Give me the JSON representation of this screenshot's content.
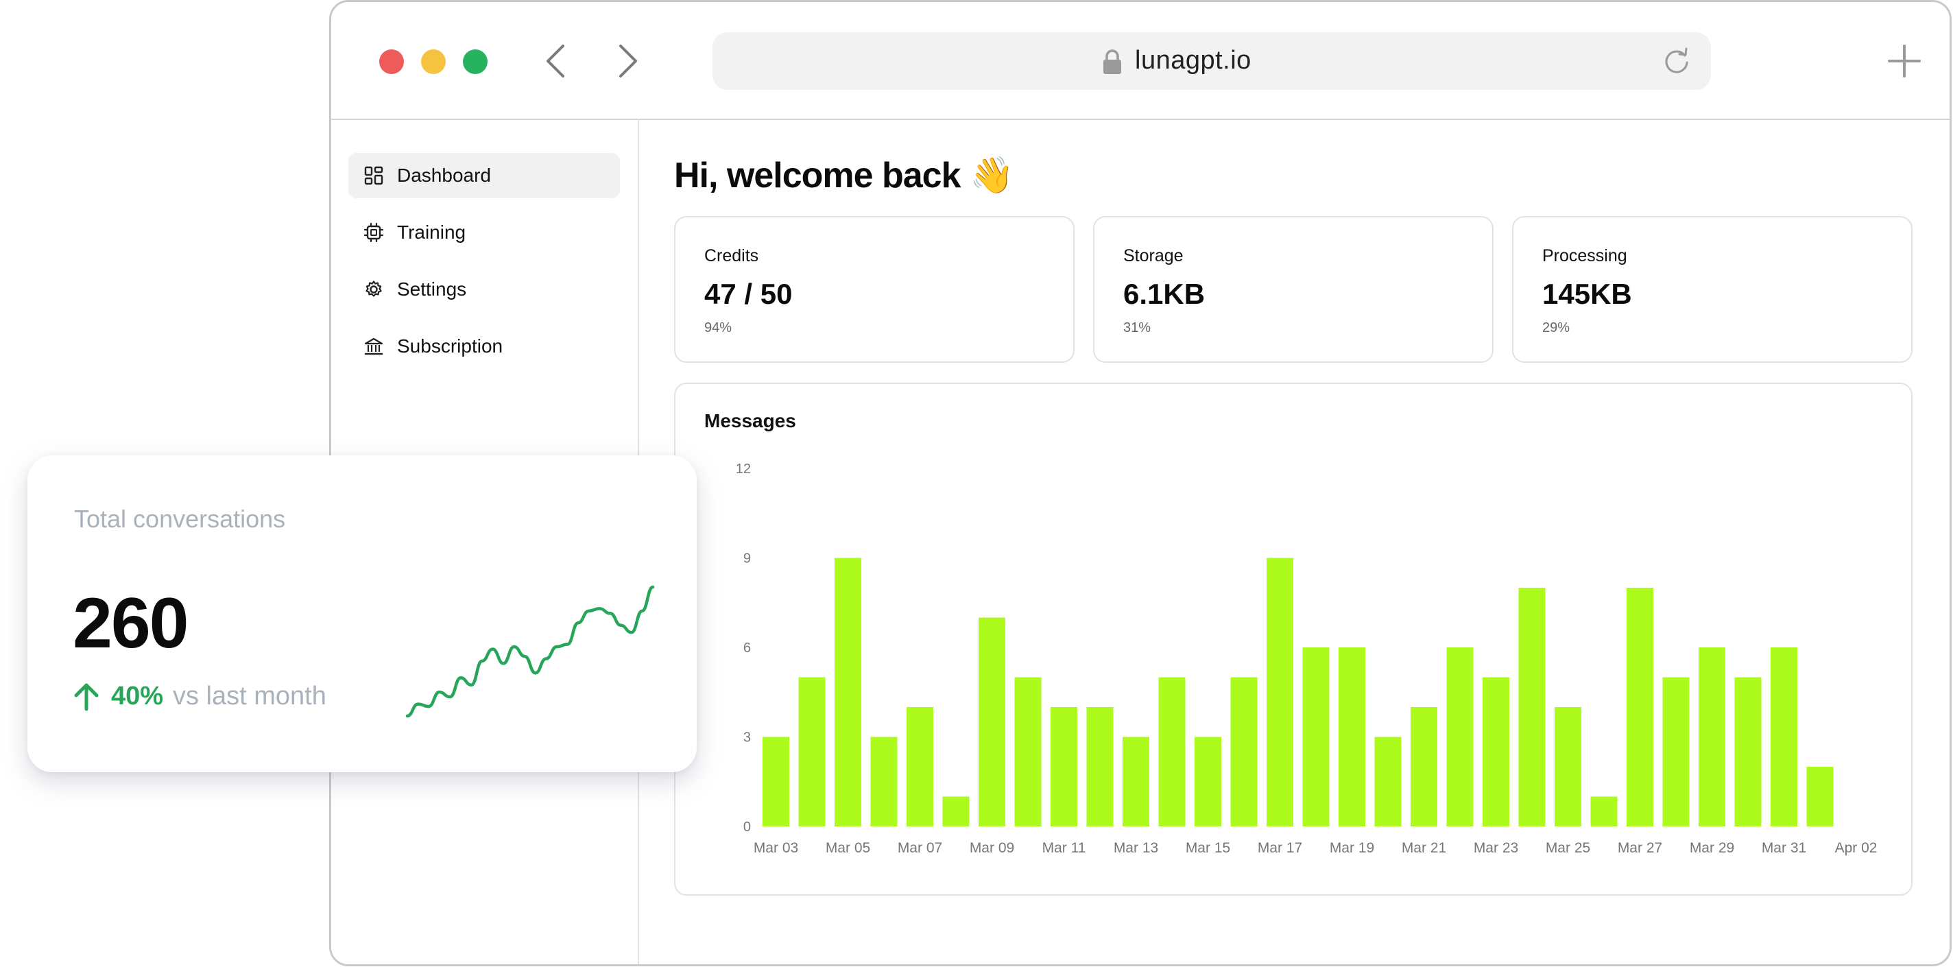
{
  "browser": {
    "url": "lunagpt.io",
    "icons": [
      "close-dot",
      "minimize-dot",
      "maximize-dot",
      "chevron-left-icon",
      "chevron-right-icon",
      "lock-icon",
      "reload-icon",
      "plus-icon"
    ]
  },
  "sidebar": {
    "items": [
      {
        "label": "Dashboard",
        "icon": "dashboard-icon",
        "active": true
      },
      {
        "label": "Training",
        "icon": "chip-icon",
        "active": false
      },
      {
        "label": "Settings",
        "icon": "gear-icon",
        "active": false
      },
      {
        "label": "Subscription",
        "icon": "bank-icon",
        "active": false
      }
    ]
  },
  "main": {
    "welcome": "Hi, welcome back 👋",
    "stats": [
      {
        "title": "Credits",
        "value": "47 / 50",
        "percent": "94%"
      },
      {
        "title": "Storage",
        "value": "6.1KB",
        "percent": "31%"
      },
      {
        "title": "Processing",
        "value": "145KB",
        "percent": "29%"
      }
    ]
  },
  "chart_data": {
    "type": "bar",
    "title": "Messages",
    "xlabel": "",
    "ylabel": "",
    "ylim": [
      0,
      12
    ],
    "yticks": [
      0,
      3,
      6,
      9,
      12
    ],
    "grid": false,
    "bar_color": "#adfa1d",
    "categories": [
      "Mar 03",
      "Mar 04",
      "Mar 05",
      "Mar 06",
      "Mar 07",
      "Mar 08",
      "Mar 09",
      "Mar 10",
      "Mar 11",
      "Mar 12",
      "Mar 13",
      "Mar 14",
      "Mar 15",
      "Mar 16",
      "Mar 17",
      "Mar 18",
      "Mar 19",
      "Mar 20",
      "Mar 21",
      "Mar 22",
      "Mar 23",
      "Mar 24",
      "Mar 25",
      "Mar 26",
      "Mar 27",
      "Mar 28",
      "Mar 29",
      "Mar 30",
      "Mar 31",
      "Apr 01"
    ],
    "values": [
      3,
      5,
      9,
      3,
      4,
      1,
      7,
      5,
      4,
      4,
      3,
      5,
      3,
      5,
      9,
      6,
      6,
      3,
      4,
      6,
      5,
      8,
      4,
      1,
      8,
      5,
      6,
      5,
      6,
      2
    ],
    "xtick_labels": [
      "Mar 03",
      "Mar 05",
      "Mar 07",
      "Mar 09",
      "Mar 11",
      "Mar 13",
      "Mar 15",
      "Mar 17",
      "Mar 19",
      "Mar 21",
      "Mar 23",
      "Mar 25",
      "Mar 27",
      "Mar 29",
      "Mar 31",
      "Apr 02"
    ]
  },
  "float_card": {
    "label": "Total conversations",
    "value": "260",
    "change": "40%",
    "comparison": "vs last month",
    "accent": "#27a65a",
    "trend": [
      2,
      12,
      10,
      22,
      18,
      34,
      28,
      48,
      58,
      46,
      60,
      52,
      38,
      50,
      60,
      62,
      80,
      90,
      92,
      88,
      78,
      72,
      90,
      110
    ]
  }
}
